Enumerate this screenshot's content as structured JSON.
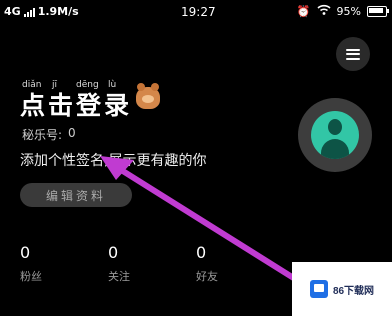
{
  "status_bar": {
    "network": "4G",
    "speed": "1.9M/s",
    "time": "19:27",
    "battery_text": "95%",
    "icons": [
      "signal-icon",
      "alarm-icon",
      "wifi-icon",
      "battery-icon"
    ]
  },
  "profile": {
    "pinyin": [
      "diǎn",
      "jī",
      "dēng",
      "lù"
    ],
    "login_title": "点击登录",
    "id_label": "秘乐号:",
    "id_value": "0",
    "signature": "添加个性签名,展示更有趣的你",
    "edit_button": "编辑资料"
  },
  "stats": [
    {
      "value": "0",
      "label": "粉丝"
    },
    {
      "value": "0",
      "label": "关注"
    },
    {
      "value": "0",
      "label": "好友"
    }
  ],
  "watermark": {
    "text": "86下载网"
  },
  "colors": {
    "background": "#000000",
    "avatar_accent": "#32c6a6",
    "arrow": "#c03bd1"
  }
}
